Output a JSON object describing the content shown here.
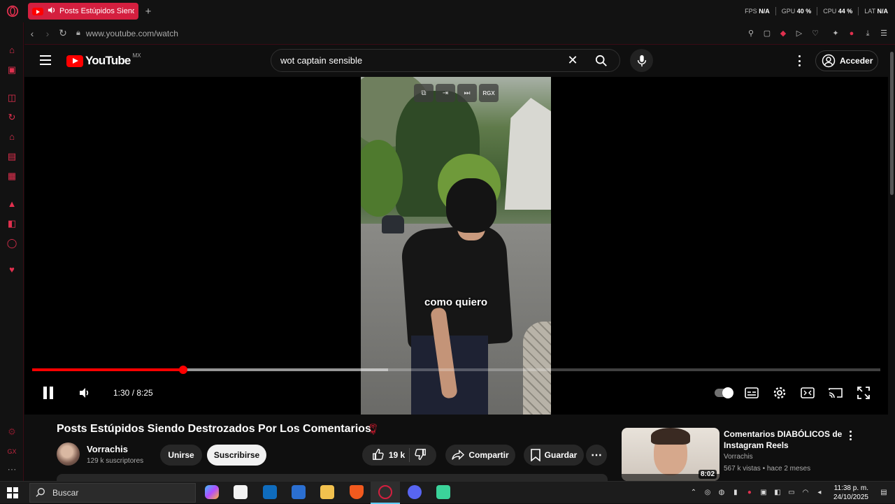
{
  "browser": {
    "tab_title": "Posts Estúpidos Siend",
    "new_tab": "+",
    "url": "www.youtube.com/watch",
    "stats": [
      {
        "label": "FPS",
        "value": "N/A"
      },
      {
        "label": "GPU",
        "value": "40 %"
      },
      {
        "label": "CPU",
        "value": "44 %"
      },
      {
        "label": "LAT",
        "value": "N/A"
      }
    ],
    "accent": "#e0304e"
  },
  "youtube": {
    "logo_word": "YouTube",
    "region": "MX",
    "search_query": "wot captain sensible",
    "sign_in": "Acceder"
  },
  "player": {
    "caption": "como quiero",
    "overlay_rgx": "RGX",
    "time": "1:30 / 8:25",
    "progress_fraction": 0.178,
    "buffer_fraction": 0.42,
    "progress_color": "#ff0000"
  },
  "video": {
    "title": "Posts Estúpidos Siendo Destrozados Por Los Comentarios",
    "channel": "Vorrachis",
    "subscribers": "129 k suscriptores",
    "join": "Unirse",
    "subscribe": "Suscribirse",
    "likes": "19 k",
    "share": "Compartir",
    "save": "Guardar"
  },
  "recommendation": {
    "title": "Comentarios DIABÓLICOS de Instagram Reels",
    "channel": "Vorrachis",
    "meta": "567 k vistas • hace 2 meses",
    "duration": "8:02"
  },
  "taskbar": {
    "search": "Buscar",
    "time": "11:38 p. m.",
    "date": "24/10/2025"
  }
}
